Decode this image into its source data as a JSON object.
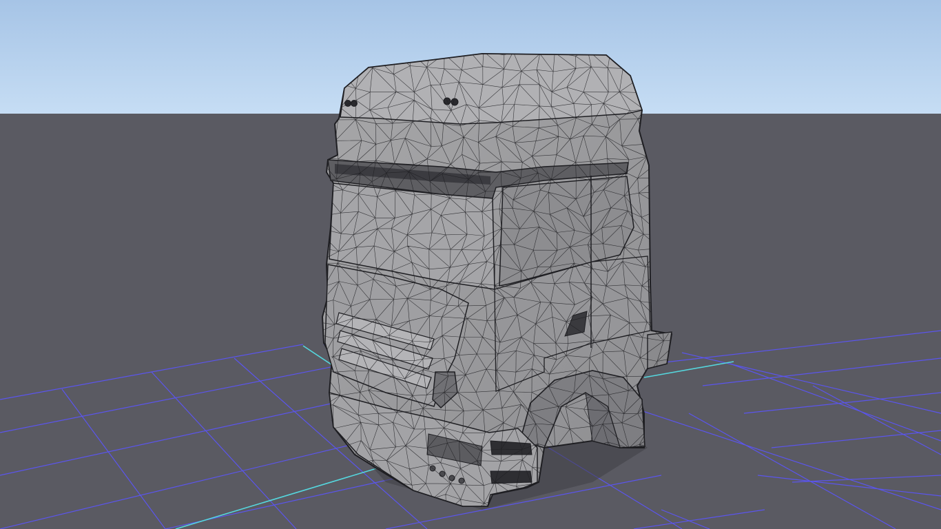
{
  "scene": {
    "sky_top_color": "#a6c4e6",
    "sky_horizon_color": "#c6ddf4",
    "ground_color": "#5a5a62",
    "grid_color": "#5b55ee",
    "axis_color": "#55d7de",
    "mesh_fill_color": "#9b9b9d",
    "mesh_shadow_color": "#6b6b70",
    "wire_color": "#1e1e22",
    "object": "truck-cab-mesh",
    "display_mode": "wireframe-on-shaded"
  }
}
